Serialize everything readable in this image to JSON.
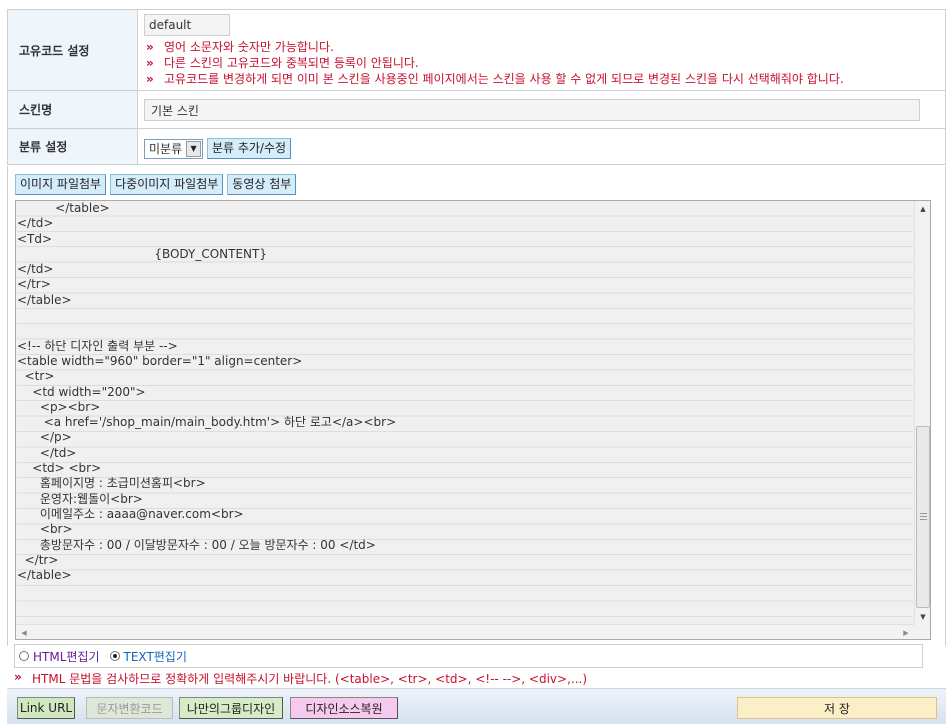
{
  "code_row": {
    "label": "고유코드 설정",
    "value": "default",
    "notes": [
      "영어 소문자와 숫자만 가능합니다.",
      "다른 스킨의 고유코드와 중복되면 등록이 안됩니다.",
      "고유코드를 변경하게 되면 이미 본 스킨을 사용중인 페이지에서는 스킨을 사용 할 수 없게 되므로 변경된 스킨을 다시 선택해줘야 합니다."
    ],
    "note_marker": "»"
  },
  "skin_row": {
    "label": "스킨명",
    "value": "기본 스킨"
  },
  "category_row": {
    "label": "분류 설정",
    "selected": "미분류",
    "edit_button": "분류 추가/수정"
  },
  "attach_buttons": {
    "image": "이미지 파일첨부",
    "multi_image": "다중이미지 파일첨부",
    "video": "동영상 첨부"
  },
  "editor": {
    "lines": [
      "          </table>",
      "</td>",
      "<Td>",
      "                                    {BODY_CONTENT}",
      "</td>",
      "</tr>",
      "</table>",
      "",
      "",
      "<!-- 하단 디자인 출력 부분 -->",
      "<table width=\"960\" border=\"1\" align=center>",
      "  <tr>",
      "    <td width=\"200\">",
      "      <p><br>",
      "       <a href='/shop_main/main_body.htm'> 하단 로고</a><br>",
      "      </p>",
      "      </td>",
      "    <td> <br>",
      "      홈페이지명 : 초급미션홈피<br>",
      "      운영자:웹돌이<br>",
      "      이메일주소 : aaaa@naver.com<br>",
      "      <br>",
      "      총방문자수 : 00 / 이달방문자수 : 00 / 오늘 방문자수 : 00 </td>",
      "  </tr>",
      "</table>",
      "",
      "",
      ""
    ]
  },
  "mode": {
    "html_label": "HTML편집기",
    "text_label": "TEXT편집기",
    "selected": "TEXT편집기"
  },
  "warning": {
    "marker": "»",
    "text": "HTML 문법을 검사하므로 정확하게 입력해주시기 바랍니다. (<table>, <tr>, <td>, <!-- -->, <div>,...)"
  },
  "bottom_buttons": {
    "link_url": "Link URL",
    "convert": "문자변환코드",
    "group_design": "나만의그룹디자인",
    "restore": "디자인소스복원",
    "save": "저 장"
  }
}
